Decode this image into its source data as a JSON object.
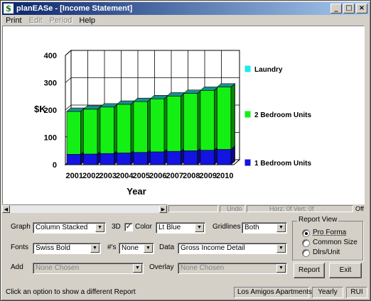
{
  "window": {
    "title": "planEASe - [Income Statement]",
    "app_icon_glyph": "$"
  },
  "title_buttons": {
    "minimize": "_",
    "maximize": "□",
    "close": "×"
  },
  "menu": [
    {
      "label": "Print",
      "enabled": true
    },
    {
      "label": "Edit",
      "enabled": false
    },
    {
      "label": "Period",
      "enabled": false
    },
    {
      "label": "Help",
      "enabled": true
    }
  ],
  "chart_data": {
    "type": "bar",
    "stacked": true,
    "three_d": true,
    "categories": [
      "2001",
      "2002",
      "2003",
      "2004",
      "2005",
      "2006",
      "2007",
      "2008",
      "2009",
      "2010"
    ],
    "series": [
      {
        "name": "1 Bedroom Units",
        "color": "#1414e0",
        "values": [
          38,
          39,
          41,
          43,
          45,
          47,
          49,
          51,
          53,
          56
        ]
      },
      {
        "name": "2 Bedroom Units",
        "color": "#14f014",
        "values": [
          157,
          164,
          170,
          178,
          186,
          194,
          202,
          210,
          219,
          228
        ]
      },
      {
        "name": "Laundry",
        "color": "#20e8f0",
        "values": [
          0,
          0,
          0,
          0,
          0,
          0,
          0,
          0,
          0,
          0
        ]
      }
    ],
    "xlabel": "Year",
    "ylabel": "$K",
    "ylim": [
      0,
      400
    ],
    "yticks": [
      "0",
      "100",
      "200",
      "300",
      "400"
    ],
    "gridlines": "Both",
    "legend_position": "right"
  },
  "scroll_status": {
    "undo": "Undo",
    "horz_vert": "Horz: 0f Vert: 0f",
    "off": "Off"
  },
  "controls": {
    "graph_label": "Graph",
    "graph_value": "Column Stacked",
    "three_d_label": "3D",
    "color_label": "Color",
    "color_checked": "✓",
    "color_value": "Lt Blue",
    "gridlines_label": "Gridlines",
    "gridlines_value": "Both",
    "fonts_label": "Fonts",
    "fonts_value": "Swiss Bold",
    "numbers_label": "#'s",
    "numbers_value": "None",
    "data_label": "Data",
    "data_value": "Gross Income Detail",
    "add_label": "Add",
    "add_value": "None Chosen",
    "overlay_label": "Overlay",
    "overlay_value": "None Chosen",
    "dropdown_glyph": "▼"
  },
  "report_view": {
    "title": "Report View",
    "options": [
      {
        "label": "Pro Forma",
        "selected": true
      },
      {
        "label": "Common Size",
        "selected": false
      },
      {
        "label": "Dlrs/Unit",
        "selected": false
      }
    ]
  },
  "buttons": {
    "report": "Report",
    "exit": "Exit"
  },
  "statusbar": {
    "hint": "Click an option to show a different Report",
    "property": "Los Amigos Apartments",
    "period": "Yearly",
    "mode": "RUI"
  }
}
